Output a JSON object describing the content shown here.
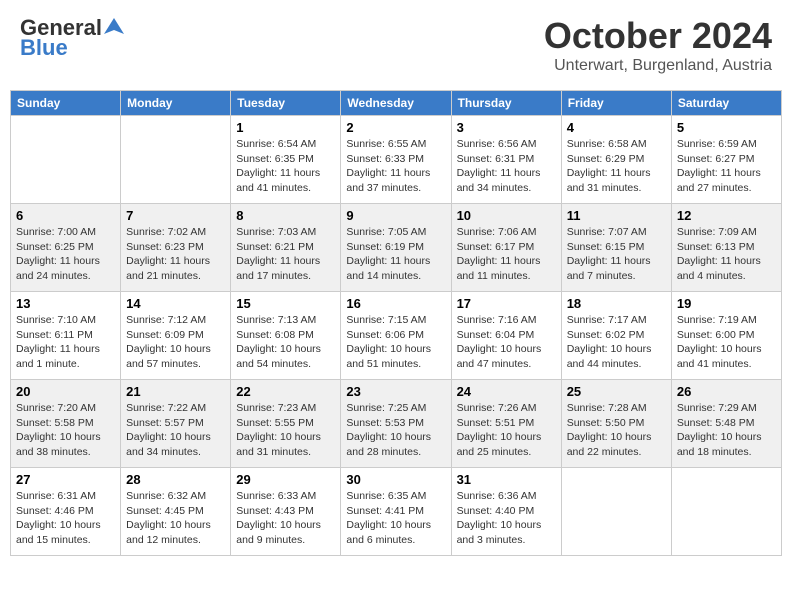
{
  "header": {
    "logo_general": "General",
    "logo_blue": "Blue",
    "month": "October 2024",
    "location": "Unterwart, Burgenland, Austria"
  },
  "days_of_week": [
    "Sunday",
    "Monday",
    "Tuesday",
    "Wednesday",
    "Thursday",
    "Friday",
    "Saturday"
  ],
  "weeks": [
    [
      {
        "day": "",
        "detail": ""
      },
      {
        "day": "",
        "detail": ""
      },
      {
        "day": "1",
        "detail": "Sunrise: 6:54 AM\nSunset: 6:35 PM\nDaylight: 11 hours and 41 minutes."
      },
      {
        "day": "2",
        "detail": "Sunrise: 6:55 AM\nSunset: 6:33 PM\nDaylight: 11 hours and 37 minutes."
      },
      {
        "day": "3",
        "detail": "Sunrise: 6:56 AM\nSunset: 6:31 PM\nDaylight: 11 hours and 34 minutes."
      },
      {
        "day": "4",
        "detail": "Sunrise: 6:58 AM\nSunset: 6:29 PM\nDaylight: 11 hours and 31 minutes."
      },
      {
        "day": "5",
        "detail": "Sunrise: 6:59 AM\nSunset: 6:27 PM\nDaylight: 11 hours and 27 minutes."
      }
    ],
    [
      {
        "day": "6",
        "detail": "Sunrise: 7:00 AM\nSunset: 6:25 PM\nDaylight: 11 hours and 24 minutes."
      },
      {
        "day": "7",
        "detail": "Sunrise: 7:02 AM\nSunset: 6:23 PM\nDaylight: 11 hours and 21 minutes."
      },
      {
        "day": "8",
        "detail": "Sunrise: 7:03 AM\nSunset: 6:21 PM\nDaylight: 11 hours and 17 minutes."
      },
      {
        "day": "9",
        "detail": "Sunrise: 7:05 AM\nSunset: 6:19 PM\nDaylight: 11 hours and 14 minutes."
      },
      {
        "day": "10",
        "detail": "Sunrise: 7:06 AM\nSunset: 6:17 PM\nDaylight: 11 hours and 11 minutes."
      },
      {
        "day": "11",
        "detail": "Sunrise: 7:07 AM\nSunset: 6:15 PM\nDaylight: 11 hours and 7 minutes."
      },
      {
        "day": "12",
        "detail": "Sunrise: 7:09 AM\nSunset: 6:13 PM\nDaylight: 11 hours and 4 minutes."
      }
    ],
    [
      {
        "day": "13",
        "detail": "Sunrise: 7:10 AM\nSunset: 6:11 PM\nDaylight: 11 hours and 1 minute."
      },
      {
        "day": "14",
        "detail": "Sunrise: 7:12 AM\nSunset: 6:09 PM\nDaylight: 10 hours and 57 minutes."
      },
      {
        "day": "15",
        "detail": "Sunrise: 7:13 AM\nSunset: 6:08 PM\nDaylight: 10 hours and 54 minutes."
      },
      {
        "day": "16",
        "detail": "Sunrise: 7:15 AM\nSunset: 6:06 PM\nDaylight: 10 hours and 51 minutes."
      },
      {
        "day": "17",
        "detail": "Sunrise: 7:16 AM\nSunset: 6:04 PM\nDaylight: 10 hours and 47 minutes."
      },
      {
        "day": "18",
        "detail": "Sunrise: 7:17 AM\nSunset: 6:02 PM\nDaylight: 10 hours and 44 minutes."
      },
      {
        "day": "19",
        "detail": "Sunrise: 7:19 AM\nSunset: 6:00 PM\nDaylight: 10 hours and 41 minutes."
      }
    ],
    [
      {
        "day": "20",
        "detail": "Sunrise: 7:20 AM\nSunset: 5:58 PM\nDaylight: 10 hours and 38 minutes."
      },
      {
        "day": "21",
        "detail": "Sunrise: 7:22 AM\nSunset: 5:57 PM\nDaylight: 10 hours and 34 minutes."
      },
      {
        "day": "22",
        "detail": "Sunrise: 7:23 AM\nSunset: 5:55 PM\nDaylight: 10 hours and 31 minutes."
      },
      {
        "day": "23",
        "detail": "Sunrise: 7:25 AM\nSunset: 5:53 PM\nDaylight: 10 hours and 28 minutes."
      },
      {
        "day": "24",
        "detail": "Sunrise: 7:26 AM\nSunset: 5:51 PM\nDaylight: 10 hours and 25 minutes."
      },
      {
        "day": "25",
        "detail": "Sunrise: 7:28 AM\nSunset: 5:50 PM\nDaylight: 10 hours and 22 minutes."
      },
      {
        "day": "26",
        "detail": "Sunrise: 7:29 AM\nSunset: 5:48 PM\nDaylight: 10 hours and 18 minutes."
      }
    ],
    [
      {
        "day": "27",
        "detail": "Sunrise: 6:31 AM\nSunset: 4:46 PM\nDaylight: 10 hours and 15 minutes."
      },
      {
        "day": "28",
        "detail": "Sunrise: 6:32 AM\nSunset: 4:45 PM\nDaylight: 10 hours and 12 minutes."
      },
      {
        "day": "29",
        "detail": "Sunrise: 6:33 AM\nSunset: 4:43 PM\nDaylight: 10 hours and 9 minutes."
      },
      {
        "day": "30",
        "detail": "Sunrise: 6:35 AM\nSunset: 4:41 PM\nDaylight: 10 hours and 6 minutes."
      },
      {
        "day": "31",
        "detail": "Sunrise: 6:36 AM\nSunset: 4:40 PM\nDaylight: 10 hours and 3 minutes."
      },
      {
        "day": "",
        "detail": ""
      },
      {
        "day": "",
        "detail": ""
      }
    ]
  ]
}
